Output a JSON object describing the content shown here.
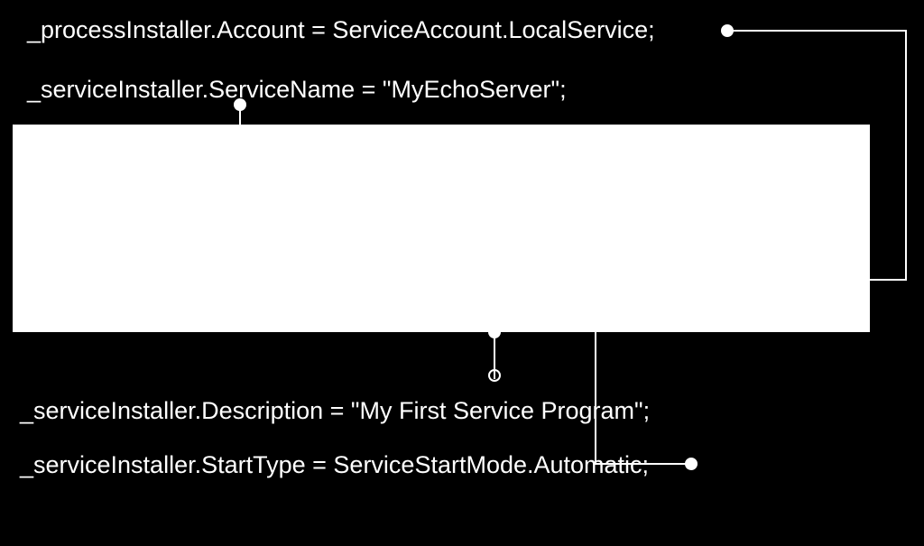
{
  "lines": {
    "l1": "_processInstaller.Account = ServiceAccount.LocalService;",
    "l2": "_serviceInstaller.ServiceName = \"MyEchoServer\";",
    "l3": "_serviceInstaller.Description = \"My First Service Program\";",
    "l4": "_serviceInstaller.StartType = ServiceStartMode.Automatic;"
  }
}
